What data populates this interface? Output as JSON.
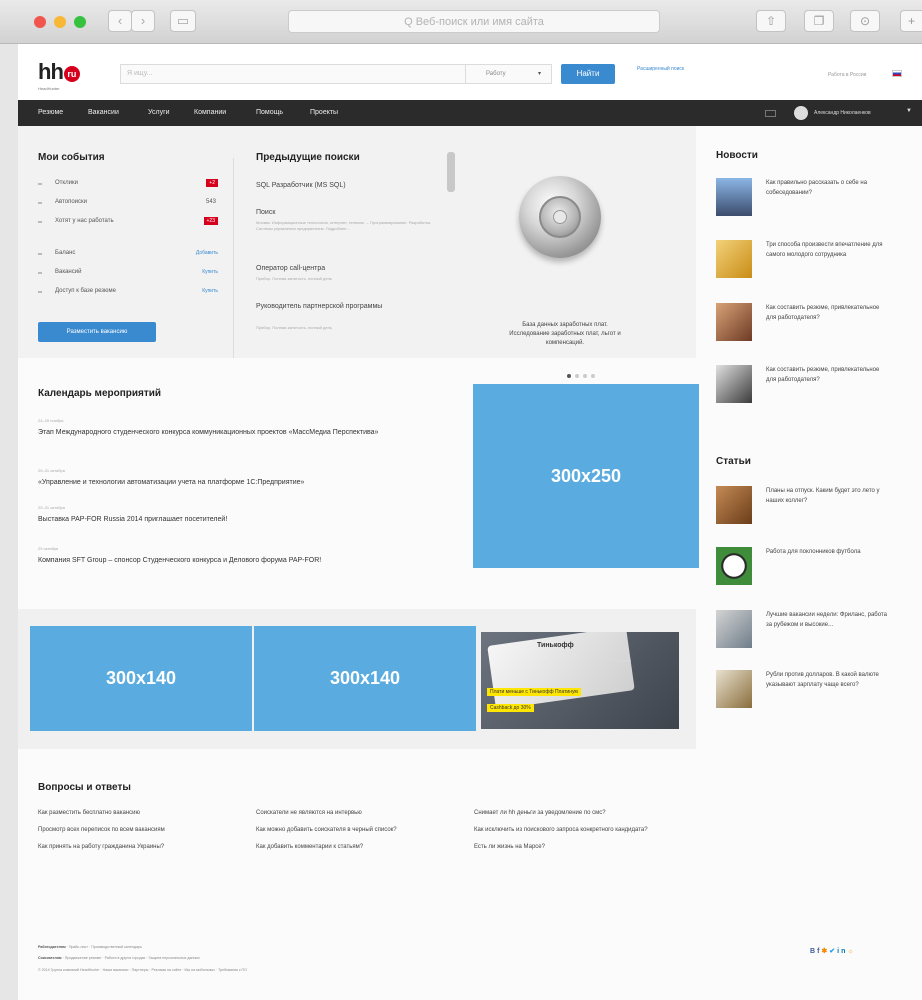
{
  "browser": {
    "address_placeholder": "Q Веб-поиск или имя сайта",
    "back_icon": "chevron-left-icon",
    "forward_icon": "chevron-right-icon"
  },
  "header": {
    "logo_text": "hh",
    "logo_badge": "ru",
    "logo_sub": "HeadHunter",
    "search_placeholder": "Я ищу...",
    "search_select": "Работу",
    "search_button": "Найти",
    "advanced_search": "Расширенный поиск",
    "region": "Работа в России"
  },
  "menu": {
    "items": [
      "Резюме",
      "Вакансии",
      "Услуги",
      "Компании",
      "Помощь",
      "Проекты"
    ],
    "user_name": "Александр Николаенков"
  },
  "my_events": {
    "title": "Мои события",
    "rows": [
      {
        "label": "Отклики",
        "badge": "+2"
      },
      {
        "label": "Автопоиски",
        "num": "543"
      },
      {
        "label": "Хотят у нас работать",
        "badge": "+23"
      }
    ],
    "services": [
      {
        "label": "Баланс",
        "link": "Добавить"
      },
      {
        "label": "Вакансий",
        "link": "Купить"
      },
      {
        "label": "Доступ к базе резюме",
        "link": "Купить"
      }
    ],
    "post_button": "Разместить вакансию"
  },
  "previous_searches": {
    "title": "Предыдущие поиски",
    "items": [
      {
        "title": "SQL Разработчик (MS SQL)",
        "desc": ""
      },
      {
        "title": "Поиск",
        "desc": "Москва. Информационные технологии, интернет, телеком → Программирование, Разработка. Системы управления предприятием. Подробнее..."
      },
      {
        "title": "Оператор call-центра",
        "desc": "Прибор. Полная занятость, полный день"
      },
      {
        "title": "Руководитель партнерской программы",
        "desc": "Прибор. Полная занятость, полный день"
      }
    ]
  },
  "promo": {
    "text": "База данных заработных плат. Исследование заработных плат, льгот и компенсаций."
  },
  "news": {
    "title": "Новости",
    "items": [
      "Как правильно рассказать о себе на собеседовании?",
      "Три способа произвести впечатление для самого молодого сотрудника",
      "Как составить резюме, привлекательное для работодателя?",
      "Как составить резюме, привлекательное для работодателя?"
    ]
  },
  "articles": {
    "title": "Статьи",
    "items": [
      "Планы на отпуск. Каким будет это лето у наших коллег?",
      "Работа для поклонников футбола",
      "Лучшие вакансии недели: Фриланс, работа за рубежом и высокие...",
      "Рубли против долларов. В какой валюте указывают зарплату чаще всего?"
    ]
  },
  "calendar": {
    "title": "Календарь мероприятий",
    "events": [
      {
        "date": "24–25 ноября",
        "text": "Этап Международного студенческого конкурса коммуникационных проектов «МассМедиа Перспектива»"
      },
      {
        "date": "29–31 октября",
        "text": "«Управление и технологии автоматизации учета на платформе 1С:Предприятие»"
      },
      {
        "date": "29–31 октября",
        "text": "Выставка PAP-FOR Russia 2014 приглашает посетителей!"
      },
      {
        "date": "29 октября",
        "text": "Компания SFT Group – спонсор Студенческого конкурса и Делового форума PAP-FOR!"
      }
    ]
  },
  "ads": {
    "big": "300x250",
    "small1": "300x140",
    "small2": "300x140",
    "tinkoff_logo": "Тинькофф",
    "tinkoff_platinum": "PLATINUM",
    "tinkoff_line1": "Плати меньше с Тинькофф Платинум",
    "tinkoff_line2": "Cashback до 30%"
  },
  "qa": {
    "title": "Вопросы и ответы",
    "col1": [
      "Как разместить бесплатно вакансию",
      "Просмотр всех переписок по всем вакансиям",
      "Как принять на работу гражданина Украины?"
    ],
    "col2": [
      "Соискатели не являются на интервью",
      "Как можно добавить соискателя в черный список?",
      "Как добавить комментарии к статьям?"
    ],
    "col3": [
      "Снимает ли hh деньги за уведомление по смс?",
      "Как исключить из поискового запроса конкретного кандидата?",
      "Есть ли жизнь на Марсе?"
    ]
  },
  "footer": {
    "line1_label": "Работодателям",
    "line1": "Прайс-лист · Производственный календарь",
    "line2_label": "Соискателям",
    "line2": "Продвижение резюме · Работа в других городах · Защита персональных данных",
    "line3": "© 2014 Группа компаний HeadHunter · Наши вакансии · Партнеры · Реклама на сайте · Мы на мобильных · Требования к ПО",
    "socials": "B f ✱ ✔ in ☼"
  },
  "colors": {
    "accent": "#3a8ad0",
    "brand_red": "#d6001c",
    "ad_blue": "#5aabdf",
    "menu_bg": "#2b2b2b"
  }
}
